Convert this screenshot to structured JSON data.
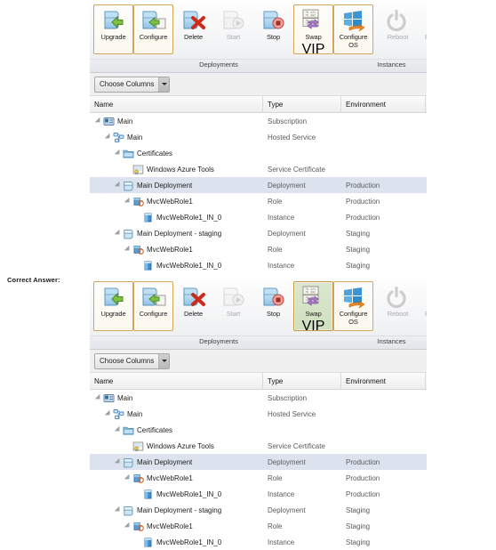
{
  "annotation": {
    "label": "Correct Answer:"
  },
  "panels": [
    {
      "id": "question",
      "swap_vip_state": "outlined"
    },
    {
      "id": "answer",
      "swap_vip_state": "highlighted-green"
    }
  ],
  "ribbon": {
    "groups": [
      {
        "name": "Deployments",
        "label": "Deployments"
      },
      {
        "name": "Instances",
        "label": "Instances"
      }
    ],
    "buttons": [
      {
        "id": "upgrade",
        "label": "Upgrade",
        "icon": "upgrade-icon",
        "group": "Deployments",
        "enabled": true,
        "selected": true
      },
      {
        "id": "configure",
        "label": "Configure",
        "icon": "configure-icon",
        "group": "Deployments",
        "enabled": true,
        "selected": true
      },
      {
        "id": "delete",
        "label": "Delete",
        "icon": "delete-icon",
        "group": "Deployments",
        "enabled": true,
        "selected": false
      },
      {
        "id": "start",
        "label": "Start",
        "icon": "start-icon",
        "group": "Deployments",
        "enabled": false,
        "selected": false
      },
      {
        "id": "stop",
        "label": "Stop",
        "icon": "stop-icon",
        "group": "Deployments",
        "enabled": true,
        "selected": false
      },
      {
        "id": "swap-vip",
        "label": "Swap\nVIP",
        "icon": "swap-vip-icon",
        "group": "Deployments",
        "enabled": true,
        "selected": true
      },
      {
        "id": "configure-os",
        "label": "Configure\nOS",
        "icon": "configure-os-icon",
        "group": "Deployments",
        "enabled": true,
        "selected": true
      },
      {
        "id": "reboot",
        "label": "Reboot",
        "icon": "reboot-icon",
        "group": "Instances",
        "enabled": false,
        "selected": false
      },
      {
        "id": "reimage",
        "label": "Reimage",
        "icon": "reimage-icon",
        "group": "Instances",
        "enabled": false,
        "selected": false
      }
    ],
    "button_labels": {
      "upgrade": "Upgrade",
      "configure": "Configure",
      "delete": "Delete",
      "start": "Start",
      "stop": "Stop",
      "swap_vip_line1": "Swap",
      "swap_vip_line2": "VIP",
      "configure_os_line1": "Configure",
      "configure_os_line2": "OS",
      "reboot": "Reboot",
      "reimage": "Reimage"
    },
    "group_labels": {
      "deployments": "Deployments",
      "instances": "Instances"
    }
  },
  "toolbar": {
    "choose_columns_label": "Choose Columns",
    "dropdown_icon": "chevron-down-icon"
  },
  "grid": {
    "columns": [
      {
        "key": "name",
        "label": "Name"
      },
      {
        "key": "type",
        "label": "Type"
      },
      {
        "key": "environment",
        "label": "Environment"
      }
    ],
    "rows": [
      {
        "name": "Main",
        "type": "Subscription",
        "environment": "",
        "depth": 0,
        "icon": "subscription-icon",
        "expander": "expanded",
        "selected": false
      },
      {
        "name": "Main",
        "type": "Hosted Service",
        "environment": "",
        "depth": 1,
        "icon": "hosted-service-icon",
        "expander": "expanded",
        "selected": false
      },
      {
        "name": "Certificates",
        "type": "",
        "environment": "",
        "depth": 2,
        "icon": "folder-icon",
        "expander": "expanded",
        "selected": false
      },
      {
        "name": "Windows Azure Tools",
        "type": "Service Certificate",
        "environment": "",
        "depth": 3,
        "icon": "certificate-icon",
        "expander": "none",
        "selected": false
      },
      {
        "name": "Main Deployment",
        "type": "Deployment",
        "environment": "Production",
        "depth": 2,
        "icon": "deployment-icon",
        "expander": "expanded",
        "selected": true
      },
      {
        "name": "MvcWebRole1",
        "type": "Role",
        "environment": "Production",
        "depth": 3,
        "icon": "role-icon",
        "expander": "expanded",
        "selected": false
      },
      {
        "name": "MvcWebRole1_IN_0",
        "type": "Instance",
        "environment": "Production",
        "depth": 4,
        "icon": "instance-icon",
        "expander": "none",
        "selected": false
      },
      {
        "name": "Main Deployment - staging",
        "type": "Deployment",
        "environment": "Staging",
        "depth": 2,
        "icon": "deployment-icon",
        "expander": "expanded",
        "selected": false
      },
      {
        "name": "MvcWebRole1",
        "type": "Role",
        "environment": "Staging",
        "depth": 3,
        "icon": "role-icon",
        "expander": "expanded",
        "selected": false
      },
      {
        "name": "MvcWebRole1_IN_0",
        "type": "Instance",
        "environment": "Staging",
        "depth": 4,
        "icon": "instance-icon",
        "expander": "none",
        "selected": false
      }
    ]
  },
  "colors": {
    "selected_button_border": "#d3a657",
    "answer_highlight_green": "#cfe0c0",
    "selected_row": "#dce3ee",
    "ribbon_bg": "#f2f3f5",
    "text": "#1d1d1d",
    "muted_text": "#5b5b5b"
  }
}
